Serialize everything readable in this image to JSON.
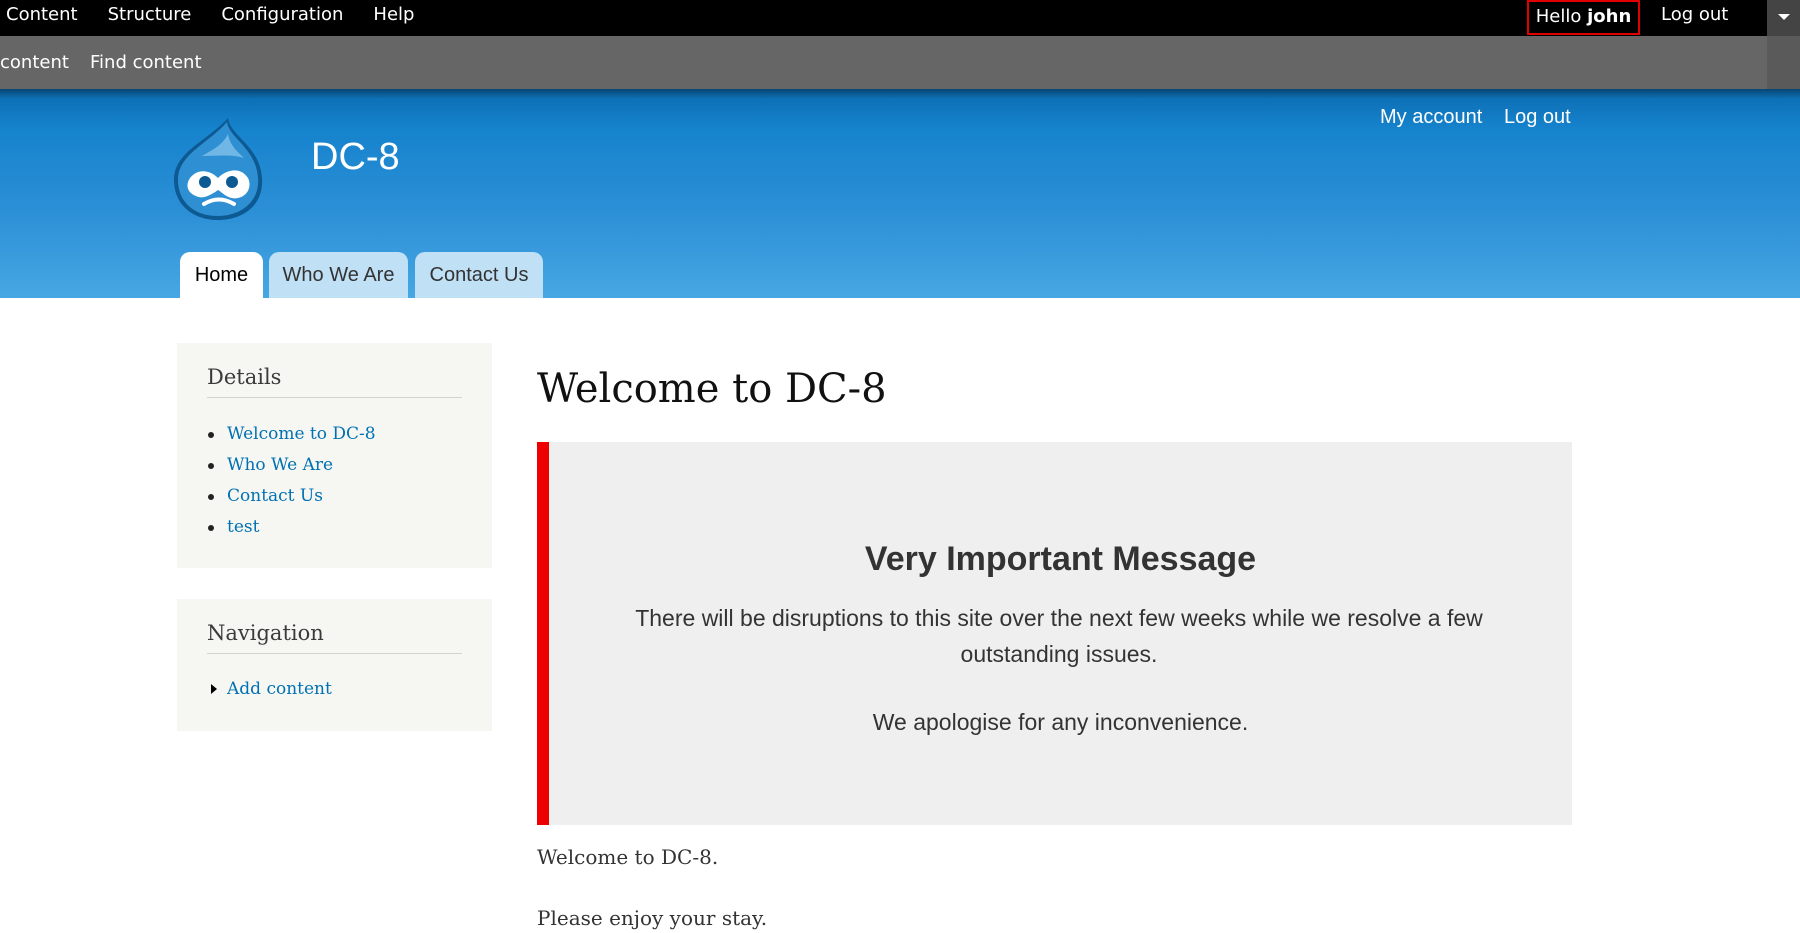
{
  "toolbar": {
    "menu": [
      "Content",
      "Structure",
      "Configuration",
      "Help"
    ],
    "hello_prefix": "Hello ",
    "user_name": "john",
    "logout": "Log out",
    "shortcuts": [
      "content",
      "Find content"
    ]
  },
  "header": {
    "site_name": "DC-8",
    "secondary_menu": [
      "My account",
      "Log out"
    ],
    "tabs": [
      "Home",
      "Who We Are",
      "Contact Us"
    ]
  },
  "sidebar": {
    "details_title": "Details",
    "details_links": [
      "Welcome to DC-8",
      "Who We Are",
      "Contact Us",
      "test"
    ],
    "navigation_title": "Navigation",
    "navigation_links": [
      "Add content"
    ]
  },
  "main": {
    "title": "Welcome to DC-8",
    "notice_heading": "Very Important Message",
    "notice_text_1": "There will be disruptions to this site over the next few weeks while we resolve a few outstanding issues.",
    "notice_text_2": "We apologise for any inconvenience.",
    "body_1": "Welcome to DC-8.",
    "body_2": "Please enjoy your stay."
  },
  "colors": {
    "toolbar_bg": "#000000",
    "shortcuts_bg": "#666666",
    "header_blue": "#1683cd",
    "notice_border": "#ee0000",
    "link": "#0071b3"
  }
}
